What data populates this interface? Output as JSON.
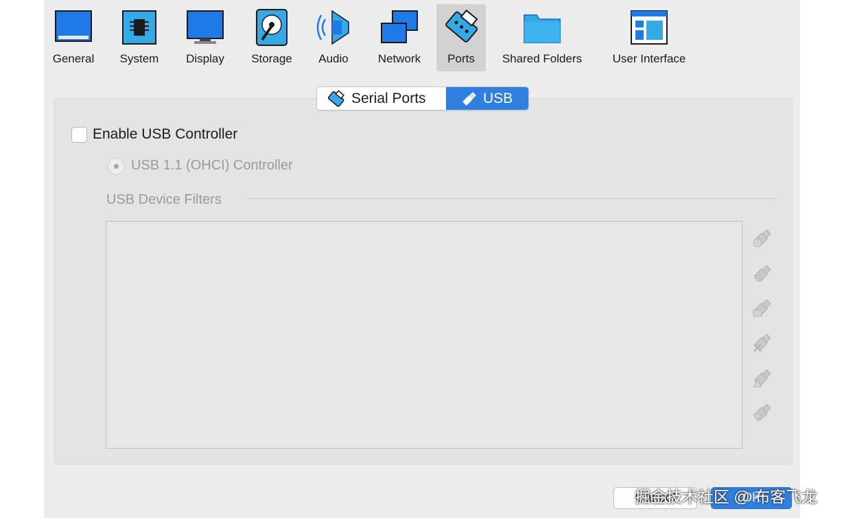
{
  "toolbar": {
    "items": [
      {
        "label": "General",
        "icon": "general-icon"
      },
      {
        "label": "System",
        "icon": "system-chip-icon"
      },
      {
        "label": "Display",
        "icon": "display-monitor-icon"
      },
      {
        "label": "Storage",
        "icon": "storage-disk-icon"
      },
      {
        "label": "Audio",
        "icon": "audio-speaker-icon"
      },
      {
        "label": "Network",
        "icon": "network-icon"
      },
      {
        "label": "Ports",
        "icon": "ports-connector-icon"
      },
      {
        "label": "Shared Folders",
        "icon": "shared-folder-icon"
      },
      {
        "label": "User Interface",
        "icon": "user-interface-icon"
      }
    ],
    "selected": "Ports"
  },
  "tabs": [
    {
      "label": "Serial Ports",
      "icon": "serial-port-icon",
      "active": false
    },
    {
      "label": "USB",
      "icon": "usb-plug-icon",
      "active": true
    }
  ],
  "usb": {
    "enable_label": "Enable USB Controller",
    "enabled": false,
    "controller_option": "USB 1.1 (OHCI) Controller",
    "filters_label": "USB Device Filters",
    "filter_actions": [
      "add-empty-filter-icon",
      "add-filter-from-device-icon",
      "edit-filter-icon",
      "remove-filter-icon",
      "move-filter-up-icon",
      "move-filter-down-icon"
    ]
  },
  "buttons": {
    "cancel": "Cancel",
    "ok": "OK"
  },
  "watermark": "掘金技术社区 @ 布客飞龙",
  "colors": {
    "accent": "#2f7fe0",
    "window_bg": "#ececec",
    "panel_bg": "#e4e4e4"
  }
}
